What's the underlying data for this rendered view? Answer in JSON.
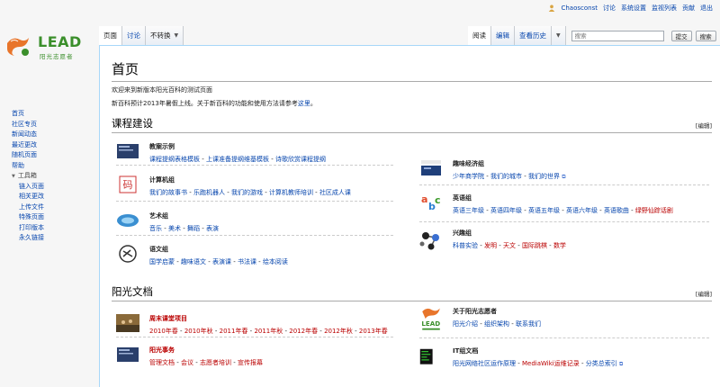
{
  "personal": {
    "username": "Chaosconst",
    "talk": "讨论",
    "preferences": "系统设置",
    "watchlist": "监视列表",
    "contributions": "贡献",
    "logout": "退出"
  },
  "logo": {
    "text": "LEAD",
    "subtitle": "阳光志愿者",
    "color": "#e8752b",
    "green": "#3b8f2b"
  },
  "tabs_left": {
    "page": "页面",
    "talk": "讨论",
    "variant": "不转换"
  },
  "tabs_right": {
    "read": "阅读",
    "edit": "编辑",
    "history": "查看历史"
  },
  "search": {
    "placeholder": "搜索",
    "go": "提交",
    "search_btn": "搜索"
  },
  "sidebar": {
    "items": [
      "首页",
      "社区专页",
      "新闻动态",
      "最近更改",
      "随机页面",
      "帮助"
    ],
    "toolbox_title": "工具箱",
    "toolbox": [
      "链入页面",
      "相关更改",
      "上传文件",
      "特殊页面",
      "打印版本",
      "永久链接"
    ]
  },
  "page": {
    "title": "首页",
    "intro1": "欢迎来到新版本阳光百科的测试页面",
    "intro2_a": "新百科预计2013年暑假上线。关于新百科的功能和使用方法请参考",
    "intro2_link": "这里",
    "intro2_end": "。"
  },
  "section1": {
    "title": "课程建设",
    "edit": "[编辑]",
    "left": [
      {
        "title": "教案示例",
        "links": [
          "课程提纲表格模板",
          "上课准备提纲维基模板",
          "诗歌欣赏课程提纲"
        ]
      },
      {
        "title": "计算机组",
        "links": [
          "我们的故事书",
          "乐跑机器人",
          "我们的游戏",
          "计算机教师培训",
          "社区成人课"
        ]
      },
      {
        "title": "艺术组",
        "links": [
          "音乐",
          "美术",
          "舞蹈",
          "表演"
        ]
      },
      {
        "title": "语文组",
        "links": [
          "国学启蒙",
          "趣味语文",
          "表演课",
          "书法课",
          "绘本阅读"
        ]
      }
    ],
    "right": [
      {
        "title": "趣味经济组",
        "links": [
          "少年商学院",
          "我们的城市",
          "我们的世界"
        ]
      },
      {
        "title": "英语组",
        "links": [
          "英语三年级",
          "英语四年级",
          "英语五年级",
          "英语六年级",
          "英语歌曲",
          "绿野仙踪话剧"
        ]
      },
      {
        "title": "兴趣组",
        "links": [
          "科普实验",
          "发明",
          "天文",
          "国际跳棋",
          "数学"
        ]
      }
    ]
  },
  "section2": {
    "title": "阳光文档",
    "edit": "[编辑]",
    "left": [
      {
        "title": "周末课堂项目",
        "links": [
          "2010年春",
          "2010年秋",
          "2011年春",
          "2011年秋",
          "2012年春",
          "2012年秋",
          "2013年春"
        ]
      },
      {
        "title": "阳光事务",
        "links": [
          "管理文档",
          "会议",
          "志愿者培训",
          "宣传报幕"
        ]
      }
    ],
    "right": [
      {
        "title": "关于阳光志愿者",
        "links": [
          "阳光介绍",
          "组织架构",
          "联系我们"
        ]
      },
      {
        "title": "IT组文档",
        "links": [
          "阳光网络社区运作原理",
          "MediaWiki运维记录",
          "分类总索引"
        ]
      }
    ]
  }
}
